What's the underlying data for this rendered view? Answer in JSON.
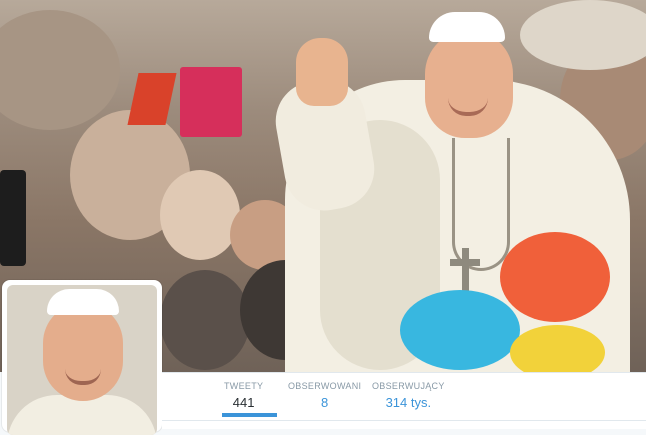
{
  "profile": {
    "header_image": "photo-header",
    "avatar_image": "avatar-photo"
  },
  "stats": [
    {
      "label": "TWEETY",
      "value": "441",
      "active": true
    },
    {
      "label": "OBSERWOWANI",
      "value": "8",
      "active": false
    },
    {
      "label": "OBSERWUJĄCY",
      "value": "314 tys.",
      "active": false
    }
  ],
  "colors": {
    "accent": "#3b94d9",
    "stat_label": "#8899a6",
    "stat_value": "#292f33"
  }
}
